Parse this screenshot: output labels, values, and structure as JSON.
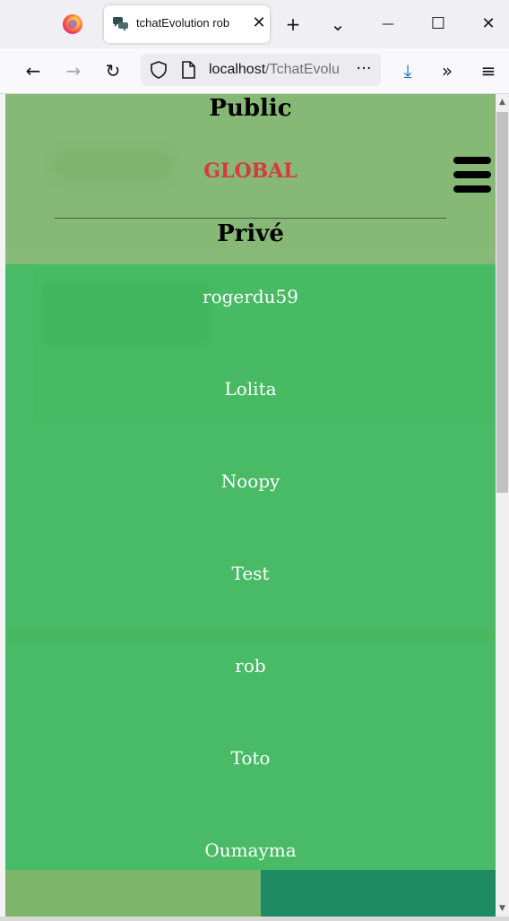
{
  "browser": {
    "tab_title": "tchatEvolution rob",
    "url_host": "localhost",
    "url_path": "/TchatEvolu",
    "new_tab": "+",
    "tab_list": "⌄",
    "minimize": "—",
    "maximize": "☐",
    "close": "✕",
    "back": "←",
    "forward": "→",
    "reload": "↻",
    "url_more": "···",
    "download": "⤓",
    "overflow": "»",
    "menu": "≡"
  },
  "menu": {
    "public_heading": "Public",
    "global_link": "GLOBAL",
    "private_heading": "Privé",
    "users": [
      "rogerdu59",
      "Lolita",
      "Noopy",
      "Test",
      "rob",
      "Toto",
      "Oumayma"
    ]
  },
  "colors": {
    "menu_top": "#7eb46e",
    "menu_bottom": "#42b860",
    "global_link": "#d9383e"
  }
}
